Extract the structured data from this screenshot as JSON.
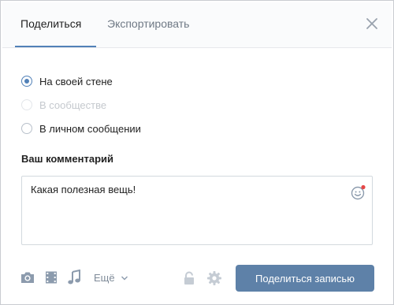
{
  "tabs": {
    "share_label": "Поделиться",
    "export_label": "Экспортировать"
  },
  "options": [
    {
      "label": "На своей стене",
      "checked": true,
      "disabled": false
    },
    {
      "label": "В сообществе",
      "checked": false,
      "disabled": true
    },
    {
      "label": "В личном сообщении",
      "checked": false,
      "disabled": false
    }
  ],
  "comment": {
    "label": "Ваш комментарий",
    "value": "Какая полезная вещь!"
  },
  "toolbar": {
    "more_label": "Ещё",
    "submit_label": "Поделиться записью"
  },
  "colors": {
    "accent": "#5181b8",
    "button": "#5e81a8",
    "icon": "#8c9bad"
  },
  "icons": [
    "close-icon",
    "emoji-icon",
    "camera-icon",
    "video-icon",
    "music-icon",
    "chevron-down-icon",
    "lock-icon",
    "gear-icon"
  ]
}
